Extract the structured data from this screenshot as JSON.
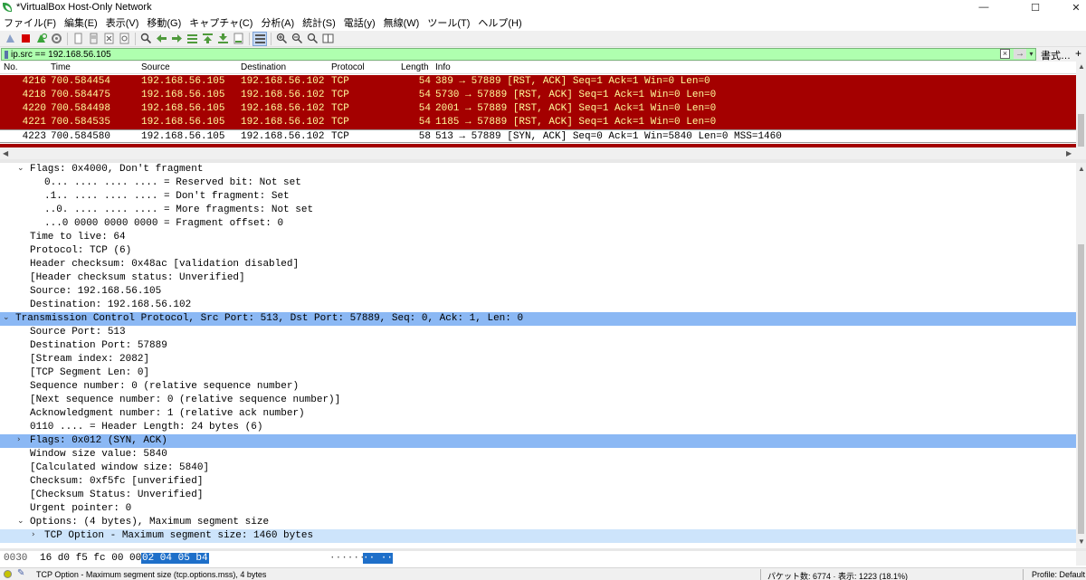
{
  "window": {
    "title": "*VirtualBox Host-Only Network",
    "minimize": "—",
    "maximize": "☐",
    "close": "✕"
  },
  "menu": [
    "ファイル(F)",
    "編集(E)",
    "表示(V)",
    "移動(G)",
    "キャプチャ(C)",
    "分析(A)",
    "統計(S)",
    "電話(y)",
    "無線(W)",
    "ツール(T)",
    "ヘルプ(H)"
  ],
  "filter": {
    "value": "ip.src == 192.168.56.105",
    "expressions_label": "書式…",
    "plus": "+"
  },
  "packet_list": {
    "columns": [
      "No.",
      "Time",
      "Source",
      "Destination",
      "Protocol",
      "Length",
      "Info"
    ],
    "rows": [
      {
        "no": "4216",
        "time": "700.584454",
        "src": "192.168.56.105",
        "dst": "192.168.56.102",
        "proto": "TCP",
        "len": "54",
        "info": "389 → 57889 [RST, ACK] Seq=1 Ack=1 Win=0 Len=0",
        "style": "rst"
      },
      {
        "no": "4218",
        "time": "700.584475",
        "src": "192.168.56.105",
        "dst": "192.168.56.102",
        "proto": "TCP",
        "len": "54",
        "info": "5730 → 57889 [RST, ACK] Seq=1 Ack=1 Win=0 Len=0",
        "style": "rst"
      },
      {
        "no": "4220",
        "time": "700.584498",
        "src": "192.168.56.105",
        "dst": "192.168.56.102",
        "proto": "TCP",
        "len": "54",
        "info": "2001 → 57889 [RST, ACK] Seq=1 Ack=1 Win=0 Len=0",
        "style": "rst"
      },
      {
        "no": "4221",
        "time": "700.584535",
        "src": "192.168.56.105",
        "dst": "192.168.56.102",
        "proto": "TCP",
        "len": "54",
        "info": "1185 → 57889 [RST, ACK] Seq=1 Ack=1 Win=0 Len=0",
        "style": "rst"
      },
      {
        "no": "4223",
        "time": "700.584580",
        "src": "192.168.56.105",
        "dst": "192.168.56.102",
        "proto": "TCP",
        "len": "58",
        "info": "513 → 57889 [SYN, ACK] Seq=0 Ack=1 Win=5840 Len=0 MSS=1460",
        "style": "sel"
      }
    ]
  },
  "details": [
    {
      "text": "Flags: 0x4000, Don't fragment",
      "indent": 2,
      "tw": "expanded",
      "hl": ""
    },
    {
      "text": "0... .... .... .... = Reserved bit: Not set",
      "indent": 3,
      "tw": "",
      "hl": ""
    },
    {
      "text": ".1.. .... .... .... = Don't fragment: Set",
      "indent": 3,
      "tw": "",
      "hl": ""
    },
    {
      "text": "..0. .... .... .... = More fragments: Not set",
      "indent": 3,
      "tw": "",
      "hl": ""
    },
    {
      "text": "...0 0000 0000 0000 = Fragment offset: 0",
      "indent": 3,
      "tw": "",
      "hl": ""
    },
    {
      "text": "Time to live: 64",
      "indent": 2,
      "tw": "",
      "hl": ""
    },
    {
      "text": "Protocol: TCP (6)",
      "indent": 2,
      "tw": "",
      "hl": ""
    },
    {
      "text": "Header checksum: 0x48ac [validation disabled]",
      "indent": 2,
      "tw": "",
      "hl": ""
    },
    {
      "text": "[Header checksum status: Unverified]",
      "indent": 2,
      "tw": "",
      "hl": ""
    },
    {
      "text": "Source: 192.168.56.105",
      "indent": 2,
      "tw": "",
      "hl": ""
    },
    {
      "text": "Destination: 192.168.56.102",
      "indent": 2,
      "tw": "",
      "hl": ""
    },
    {
      "text": "Transmission Control Protocol, Src Port: 513, Dst Port: 57889, Seq: 0, Ack: 1, Len: 0",
      "indent": 1,
      "tw": "expanded",
      "hl": "hl"
    },
    {
      "text": "Source Port: 513",
      "indent": 2,
      "tw": "",
      "hl": ""
    },
    {
      "text": "Destination Port: 57889",
      "indent": 2,
      "tw": "",
      "hl": ""
    },
    {
      "text": "[Stream index: 2082]",
      "indent": 2,
      "tw": "",
      "hl": ""
    },
    {
      "text": "[TCP Segment Len: 0]",
      "indent": 2,
      "tw": "",
      "hl": ""
    },
    {
      "text": "Sequence number: 0    (relative sequence number)",
      "indent": 2,
      "tw": "",
      "hl": ""
    },
    {
      "text": "[Next sequence number: 0    (relative sequence number)]",
      "indent": 2,
      "tw": "",
      "hl": ""
    },
    {
      "text": "Acknowledgment number: 1    (relative ack number)",
      "indent": 2,
      "tw": "",
      "hl": ""
    },
    {
      "text": "0110 .... = Header Length: 24 bytes (6)",
      "indent": 2,
      "tw": "",
      "hl": ""
    },
    {
      "text": "Flags: 0x012 (SYN, ACK)",
      "indent": 2,
      "tw": "collapsed",
      "hl": "hl"
    },
    {
      "text": "Window size value: 5840",
      "indent": 2,
      "tw": "",
      "hl": ""
    },
    {
      "text": "[Calculated window size: 5840]",
      "indent": 2,
      "tw": "",
      "hl": ""
    },
    {
      "text": "Checksum: 0xf5fc [unverified]",
      "indent": 2,
      "tw": "",
      "hl": ""
    },
    {
      "text": "[Checksum Status: Unverified]",
      "indent": 2,
      "tw": "",
      "hl": ""
    },
    {
      "text": "Urgent pointer: 0",
      "indent": 2,
      "tw": "",
      "hl": ""
    },
    {
      "text": "Options: (4 bytes), Maximum segment size",
      "indent": 2,
      "tw": "expanded",
      "hl": ""
    },
    {
      "text": "TCP Option - Maximum segment size: 1460 bytes",
      "indent": 3,
      "tw": "collapsed",
      "hl": "hl-light"
    }
  ],
  "bytes": {
    "offset": "0030",
    "hex_plain": "16 d0 f5 fc 00 00",
    "hex_selected": "02 04  05 b4",
    "ascii_plain": "······",
    "ascii_selected": "·· ··"
  },
  "status": {
    "field": "TCP Option - Maximum segment size (tcp.options.mss), 4 bytes",
    "packets": "パケット数: 6774 · 表示: 1223 (18.1%)",
    "profile": "Profile: Default"
  },
  "colors": {
    "rst_bg": "#a40000",
    "rst_fg": "#fffc9c",
    "filter_bg": "#afffaf",
    "selected_field": "#8bb8f4"
  }
}
